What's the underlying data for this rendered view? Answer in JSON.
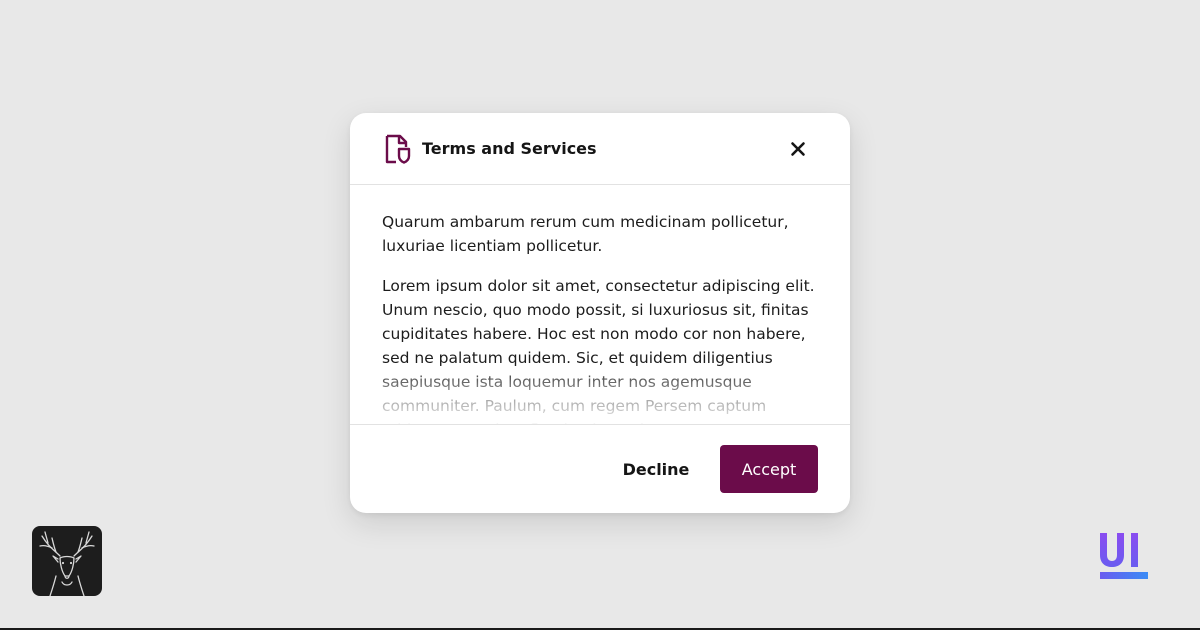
{
  "modal": {
    "title": "Terms and Services",
    "paragraphs": [
      "Quarum ambarum rerum cum medicinam pollicetur, luxuriae licentiam pollicetur.",
      "Lorem ipsum dolor sit amet, consectetur adipiscing elit. Unum nescio, quo modo possit, si luxuriosus sit, finitas cupiditates habere. Hoc est non modo cor non habere, sed ne palatum quidem. Sic, et quidem diligentius saepiusque ista loquemur inter nos agemusque communiter. Paulum, cum regem Persem captum adduceret, eodem flumine invectio?"
    ],
    "decline_label": "Decline",
    "accept_label": "Accept"
  },
  "icons": {
    "document": "document-shield-icon",
    "close": "close-icon",
    "logo": "ui-logo",
    "avatar": "deer-avatar"
  },
  "colors": {
    "background": "#e8e8e8",
    "accent": "#6b0c4a",
    "logo_purple": "#8a4cf0",
    "logo_blue": "#3b8cf5"
  }
}
